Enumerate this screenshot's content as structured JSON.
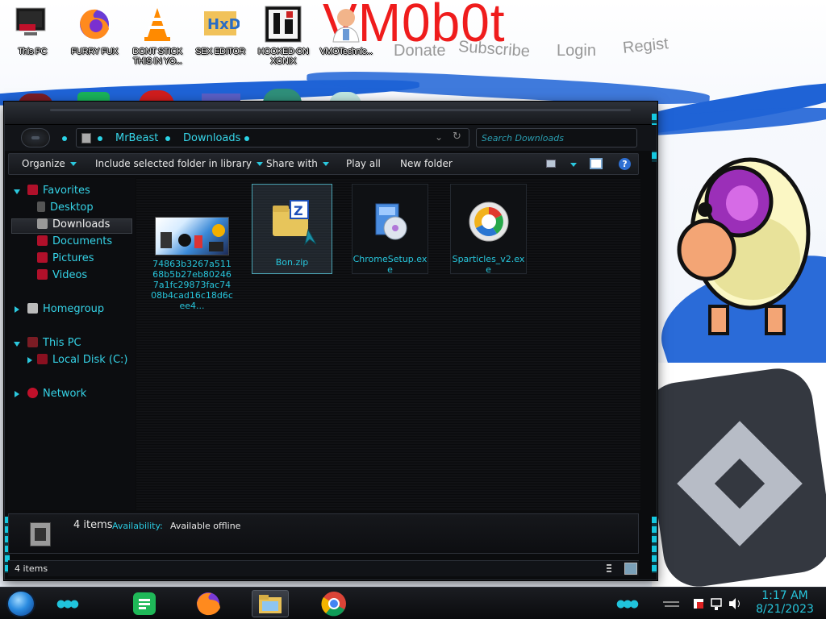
{
  "wallpaper": {
    "title": "VM0b0t",
    "faint_words": [
      "Donate",
      "Subscribe",
      "Login",
      "Regist"
    ]
  },
  "desktop_icons": [
    {
      "name": "this-pc",
      "label": "This PC"
    },
    {
      "name": "furry-fux",
      "label": "FURRY FUX"
    },
    {
      "name": "dont-stick",
      "label": "DONT STICK THIS IN YO..."
    },
    {
      "name": "sex-editor",
      "label": "SEX EDITOR"
    },
    {
      "name": "hooked-on-xonix",
      "label": "HOOKED ON XONIX"
    },
    {
      "name": "vmotechnic",
      "label": "VMOTechnic..."
    }
  ],
  "address": {
    "segments": [
      "MrBeast",
      "Downloads"
    ]
  },
  "search": {
    "placeholder": "Search Downloads"
  },
  "toolbar": {
    "organize": "Organize",
    "include": "Include selected folder in library",
    "share": "Share with",
    "play_all": "Play all",
    "new_folder": "New folder",
    "help": "?"
  },
  "navpane": {
    "favorites": "Favorites",
    "desktop": "Desktop",
    "downloads": "Downloads",
    "documents": "Documents",
    "pictures": "Pictures",
    "videos": "Videos",
    "homegroup": "Homegroup",
    "this_pc": "This PC",
    "local_disk": "Local Disk (C:)",
    "network": "Network"
  },
  "files": [
    {
      "name": "74863b3267a51168b5b27eb802467a1fc29873fac7408b4cad16c18d6cee4..."
    },
    {
      "name": "Bon.zip"
    },
    {
      "name": "ChromeSetup.exe"
    },
    {
      "name": "Sparticles_v2.exe"
    }
  ],
  "details": {
    "count": "4 items",
    "availability_label": "Availability:",
    "availability_value": "Available offline"
  },
  "status": {
    "count": "4 items"
  },
  "clock": {
    "time": "1:17 AM",
    "date": "8/21/2023"
  },
  "colors": {
    "accent": "#2bc8de",
    "title_red": "#ef1c1c",
    "wallpaper_blue": "#1f63d6"
  }
}
